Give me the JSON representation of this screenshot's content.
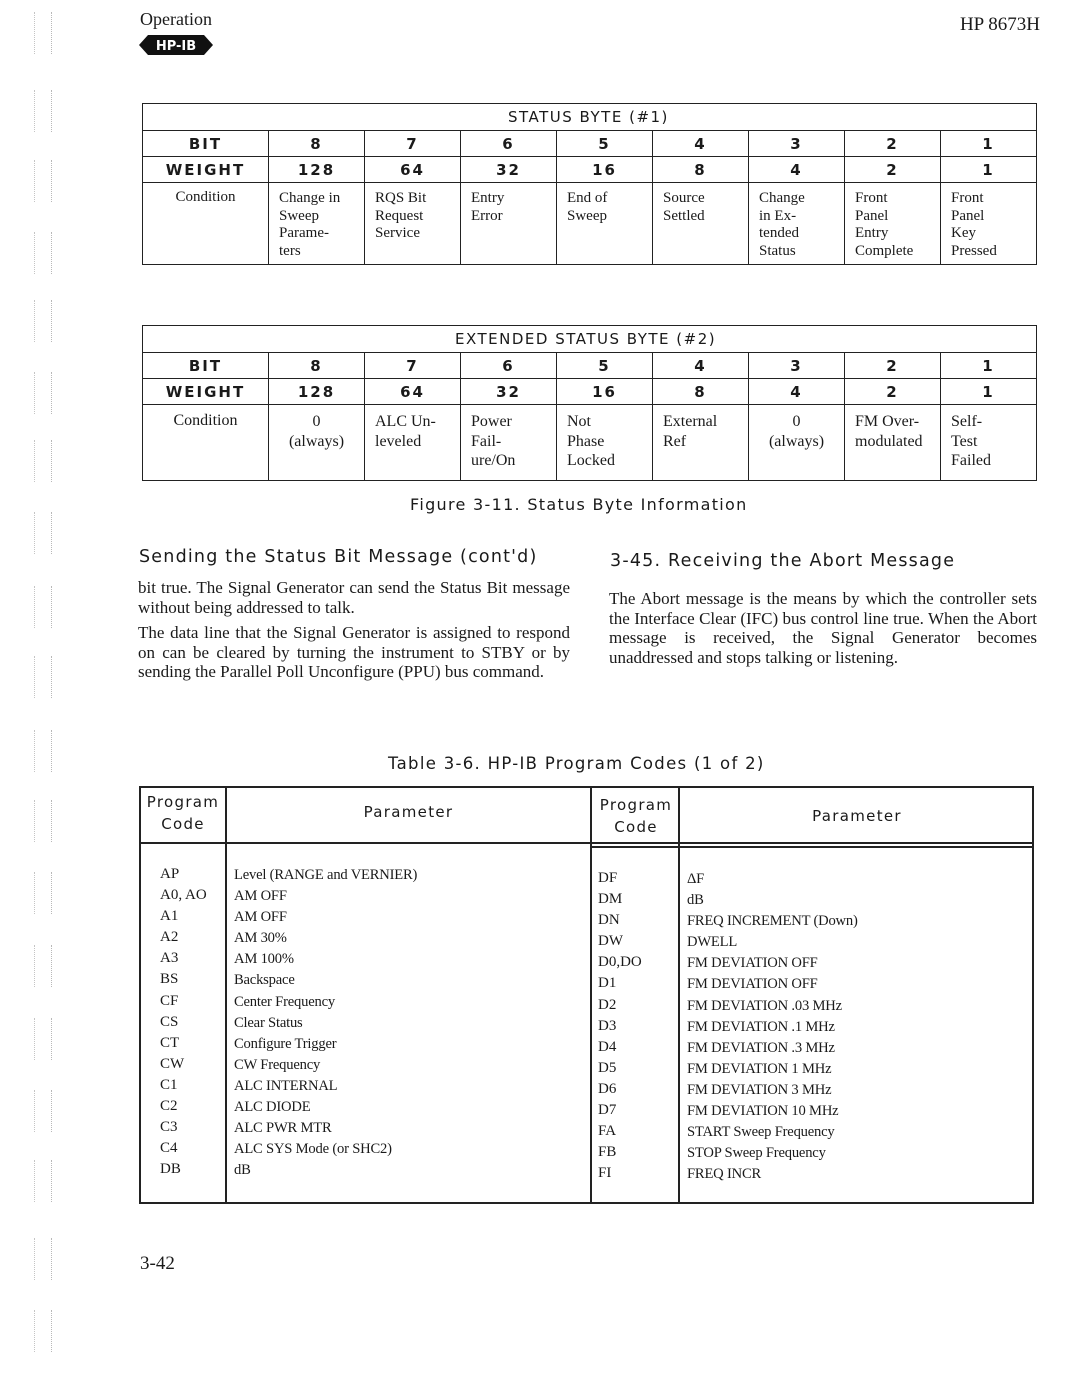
{
  "header": {
    "section": "Operation",
    "badge": "HP-IB",
    "model": "HP 8673H"
  },
  "status_byte_1": {
    "title": "STATUS BYTE (#1)",
    "row_labels": {
      "bit": "BIT",
      "weight": "WEIGHT",
      "condition": "Condition"
    },
    "bits": [
      "8",
      "7",
      "6",
      "5",
      "4",
      "3",
      "2",
      "1"
    ],
    "weights": [
      "128",
      "64",
      "32",
      "16",
      "8",
      "4",
      "2",
      "1"
    ],
    "conditions": [
      [
        "Change in",
        "Sweep",
        "Parame-",
        "ters"
      ],
      [
        "RQS Bit",
        "Request",
        "Service"
      ],
      [
        "Entry",
        "Error"
      ],
      [
        "End of",
        "Sweep"
      ],
      [
        "Source",
        "Settled"
      ],
      [
        "Change",
        "in Ex-",
        "tended",
        "Status"
      ],
      [
        "Front",
        "Panel",
        "Entry",
        "Complete"
      ],
      [
        "Front",
        "Panel",
        "Key",
        "Pressed"
      ]
    ]
  },
  "status_byte_2": {
    "title": "EXTENDED STATUS BYTE (#2)",
    "row_labels": {
      "bit": "BIT",
      "weight": "WEIGHT",
      "condition": "Condition"
    },
    "bits": [
      "8",
      "7",
      "6",
      "5",
      "4",
      "3",
      "2",
      "1"
    ],
    "weights": [
      "128",
      "64",
      "32",
      "16",
      "8",
      "4",
      "2",
      "1"
    ],
    "conditions": [
      [
        "0",
        "(always)"
      ],
      [
        "ALC Un-",
        "leveled"
      ],
      [
        "Power",
        "Fail-",
        "ure/On"
      ],
      [
        "Not",
        "Phase",
        "Locked"
      ],
      [
        "External",
        "Ref"
      ],
      [
        "0",
        "(always)"
      ],
      [
        "FM Over-",
        "modulated"
      ],
      [
        "Self-",
        "Test",
        "Failed"
      ]
    ]
  },
  "figure_caption": "Figure 3-11. Status Byte Information",
  "left_column": {
    "heading": "Sending the Status Bit Message (cont'd)",
    "paragraphs": [
      "bit true. The Signal Generator can send the Status Bit message without being addressed to talk.",
      "The data line that the Signal Generator is assigned to respond on can be cleared by turning the instrument to STBY or by sending the Parallel Poll Unconfigure (PPU) bus command."
    ]
  },
  "right_column": {
    "heading": "3-45. Receiving the Abort Message",
    "paragraphs": [
      "The Abort message is the means by which the controller sets the Interface Clear (IFC) bus control line true. When the Abort message is received, the Signal Generator becomes unaddressed and stops talking or listening."
    ]
  },
  "program_codes_table": {
    "caption": "Table 3-6. HP-IB Program Codes (1 of 2)",
    "headers": {
      "code_line1": "Program",
      "code_line2": "Code",
      "parameter": "Parameter"
    },
    "left_rows": [
      {
        "code": "AP",
        "parameter": "Level (RANGE and VERNIER)"
      },
      {
        "code": "A0, AO",
        "parameter": "AM OFF"
      },
      {
        "code": "A1",
        "parameter": "AM OFF"
      },
      {
        "code": "A2",
        "parameter": "AM 30%"
      },
      {
        "code": "A3",
        "parameter": "AM 100%"
      },
      {
        "code": "BS",
        "parameter": "Backspace"
      },
      {
        "code": "CF",
        "parameter": "Center Frequency"
      },
      {
        "code": "CS",
        "parameter": "Clear Status"
      },
      {
        "code": "CT",
        "parameter": "Configure Trigger"
      },
      {
        "code": "CW",
        "parameter": "CW Frequency"
      },
      {
        "code": "C1",
        "parameter": "ALC INTERNAL"
      },
      {
        "code": "C2",
        "parameter": "ALC DIODE"
      },
      {
        "code": "C3",
        "parameter": "ALC PWR MTR"
      },
      {
        "code": "C4",
        "parameter": "ALC SYS Mode (or SHC2)"
      },
      {
        "code": "DB",
        "parameter": "dB"
      }
    ],
    "right_rows": [
      {
        "code": "DF",
        "parameter": "ΔF"
      },
      {
        "code": "DM",
        "parameter": "dB"
      },
      {
        "code": "DN",
        "parameter": "FREQ INCREMENT (Down)"
      },
      {
        "code": "DW",
        "parameter": "DWELL"
      },
      {
        "code": "D0,DO",
        "parameter": "FM DEVIATION OFF"
      },
      {
        "code": "D1",
        "parameter": "FM DEVIATION OFF"
      },
      {
        "code": "D2",
        "parameter": "FM DEVIATION .03 MHz"
      },
      {
        "code": "D3",
        "parameter": "FM DEVIATION .1 MHz"
      },
      {
        "code": "D4",
        "parameter": "FM DEVIATION .3 MHz"
      },
      {
        "code": "D5",
        "parameter": "FM DEVIATION 1 MHz"
      },
      {
        "code": "D6",
        "parameter": "FM DEVIATION 3 MHz"
      },
      {
        "code": "D7",
        "parameter": "FM DEVIATION 10 MHz"
      },
      {
        "code": "FA",
        "parameter": "START Sweep Frequency"
      },
      {
        "code": "FB",
        "parameter": "STOP Sweep Frequency"
      },
      {
        "code": "FI",
        "parameter": "FREQ INCR"
      }
    ]
  },
  "page_number": "3-42"
}
